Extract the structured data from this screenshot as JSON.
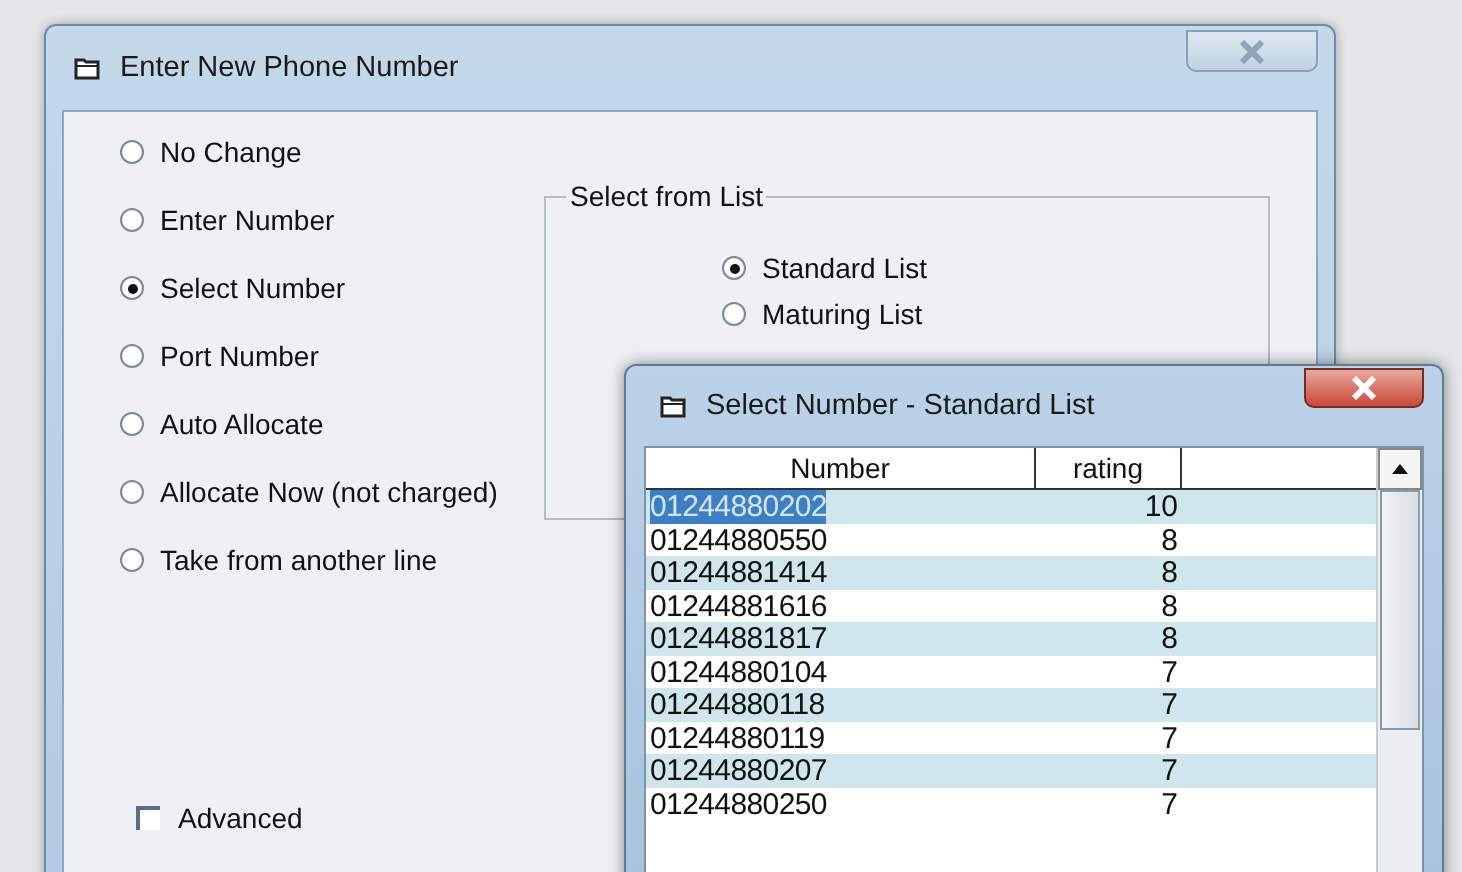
{
  "main_window": {
    "title": "Enter New Phone Number",
    "options": [
      {
        "label": "No Change",
        "selected": false
      },
      {
        "label": "Enter Number",
        "selected": false
      },
      {
        "label": "Select Number",
        "selected": true
      },
      {
        "label": "Port Number",
        "selected": false
      },
      {
        "label": "Auto Allocate",
        "selected": false
      },
      {
        "label": "Allocate Now (not charged)",
        "selected": false
      },
      {
        "label": "Take from another line",
        "selected": false
      }
    ],
    "group": {
      "title": "Select from List",
      "options": [
        {
          "label": "Standard List",
          "selected": true
        },
        {
          "label": "Maturing List",
          "selected": false
        }
      ]
    },
    "advanced": {
      "label": "Advanced",
      "checked": false
    }
  },
  "list_window": {
    "title": "Select Number - Standard List",
    "columns": [
      "Number",
      "rating"
    ],
    "rows": [
      {
        "number": "01244880202",
        "rating": "10",
        "selected": true
      },
      {
        "number": "01244880550",
        "rating": "8",
        "selected": false
      },
      {
        "number": "01244881414",
        "rating": "8",
        "selected": false
      },
      {
        "number": "01244881616",
        "rating": "8",
        "selected": false
      },
      {
        "number": "01244881817",
        "rating": "8",
        "selected": false
      },
      {
        "number": "01244880104",
        "rating": "7",
        "selected": false
      },
      {
        "number": "01244880118",
        "rating": "7",
        "selected": false
      },
      {
        "number": "01244880119",
        "rating": "7",
        "selected": false
      },
      {
        "number": "01244880207",
        "rating": "7",
        "selected": false
      },
      {
        "number": "01244880250",
        "rating": "7",
        "selected": false
      }
    ]
  }
}
